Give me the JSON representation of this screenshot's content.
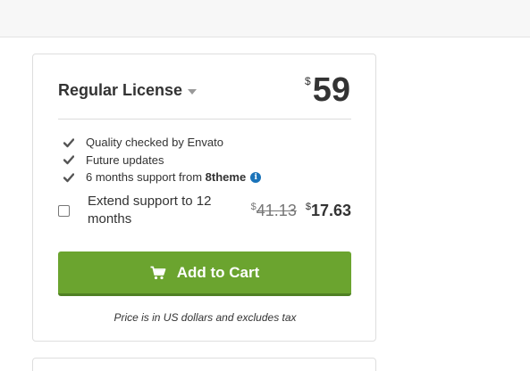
{
  "license": {
    "title": "Regular License",
    "currency_symbol": "$",
    "price": "59"
  },
  "features": [
    {
      "text": "Quality checked by Envato"
    },
    {
      "text": "Future updates"
    },
    {
      "text": "6 months support from ",
      "author": "8theme",
      "info_icon": "i"
    }
  ],
  "extend_support": {
    "label": "Extend support to 12 months",
    "checked": false,
    "old_currency": "$",
    "old_price": "41.13",
    "new_currency": "$",
    "new_price": "17.63"
  },
  "cart_button": {
    "label": "Add to Cart",
    "icon": "cart-icon",
    "color": "#6ba42f"
  },
  "price_note": "Price is in US dollars and excludes tax"
}
